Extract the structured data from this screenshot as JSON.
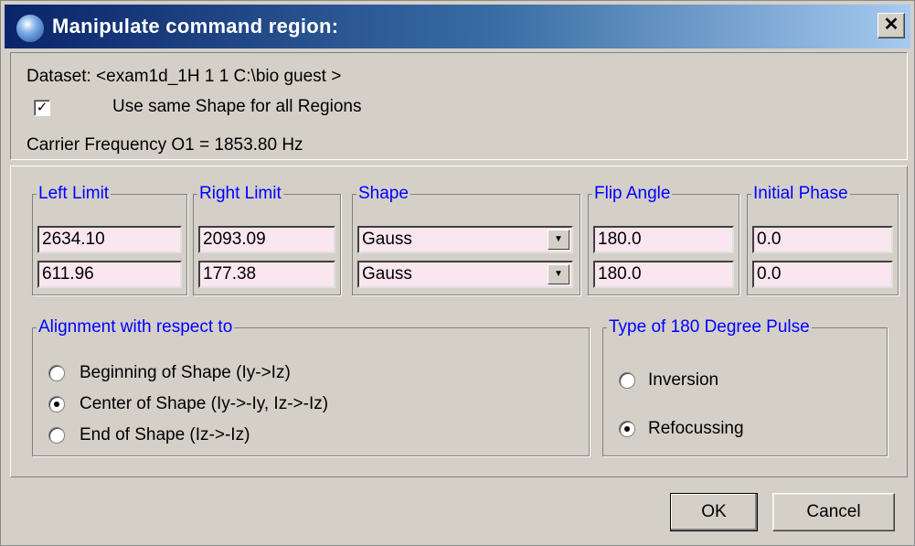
{
  "window": {
    "title": "Manipulate command region:",
    "close_label": "✕"
  },
  "info": {
    "dataset": "Dataset: <exam1d_1H 1 1 C:\\bio guest >",
    "same_shape_label": "Use same Shape for all Regions",
    "same_shape_checked": true,
    "check_mark": "✓",
    "carrier": "Carrier Frequency O1 = 1853.80 Hz"
  },
  "columns": {
    "left_limit": "Left Limit",
    "right_limit": "Right Limit",
    "shape": "Shape",
    "flip_angle": "Flip Angle",
    "initial_phase": "Initial Phase"
  },
  "rows": [
    {
      "left": "2634.10",
      "right": "2093.09",
      "shape": "Gauss",
      "flip": "180.0",
      "phase": "0.0"
    },
    {
      "left": "611.96",
      "right": "177.38",
      "shape": "Gauss",
      "flip": "180.0",
      "phase": "0.0"
    }
  ],
  "alignment": {
    "title": "Alignment with respect to",
    "options": [
      {
        "label": "Beginning of Shape (Iy->Iz)",
        "selected": false
      },
      {
        "label": "Center of Shape (Iy->-Iy, Iz->-Iz)",
        "selected": true
      },
      {
        "label": "End of Shape (Iz->-Iz)",
        "selected": false
      }
    ]
  },
  "pulse_type": {
    "title": "Type of 180 Degree Pulse",
    "options": [
      {
        "label": "Inversion",
        "selected": false
      },
      {
        "label": "Refocussing",
        "selected": true
      }
    ]
  },
  "buttons": {
    "ok_label": "OK",
    "cancel_label": "Cancel"
  },
  "icons": {
    "combo_arrow": "▼"
  },
  "colors": {
    "title_bar": "#0a246a",
    "group_label": "#0000ff",
    "field_bg": "#f9e6ee",
    "dialog_bg": "#d4d0c8"
  }
}
